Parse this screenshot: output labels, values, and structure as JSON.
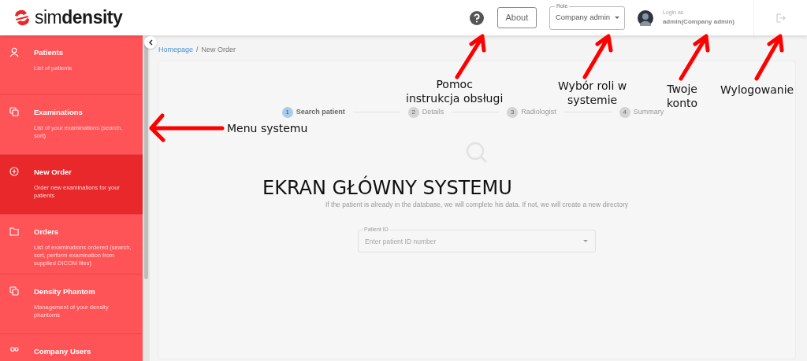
{
  "header": {
    "logo": "sim**density**",
    "about_button": "About",
    "role_select": {
      "label": "Role",
      "value": "Company admin"
    },
    "user": {
      "caption": "Login as",
      "name": "admin(Company admin)"
    }
  },
  "sidebar": {
    "items": [
      {
        "title": "Patients",
        "description": "List of patients",
        "selected": false
      },
      {
        "title": "Examinations",
        "description": "List of your examinations (search, sort)",
        "selected": false
      },
      {
        "title": "New Order",
        "description": "Order new examinations for your patients",
        "selected": true
      },
      {
        "title": "Orders",
        "description": "List of examinations ordered (search, sort, perform examination from supplied DICOM files)",
        "selected": false
      },
      {
        "title": "Density Phantom",
        "description": "Management of your density phantoms",
        "selected": false
      },
      {
        "title": "Company Users",
        "selected": false
      }
    ]
  },
  "breadcrumb": {
    "separator": "/",
    "items": [
      "Homepage",
      "New Order"
    ]
  },
  "stepper": [
    {
      "number": "1",
      "label": "Search patient",
      "selected": true
    },
    {
      "number": "2",
      "label": "Details",
      "selected": false
    },
    {
      "number": "3",
      "label": "Radiologist",
      "selected": false
    },
    {
      "number": "4",
      "label": "Summary",
      "selected": false
    }
  ],
  "subtitle": "If the patient is already in the database, we will complete his data. If not, we will create a new directory",
  "patient_field": {
    "label": "Patient ID",
    "placeholder": "Enter patient ID number"
  },
  "annotations": [
    {
      "lines": [
        "Menu systemu"
      ]
    },
    {
      "lines": [
        "Pomoc",
        "instrukcja obsługi"
      ]
    },
    {
      "lines": [
        "Wybór roli w",
        "systemie"
      ]
    },
    {
      "lines": [
        "Twoje",
        "konto"
      ]
    },
    {
      "lines": [
        "Wylogowanie"
      ]
    }
  ],
  "headline": "EKRAN GŁÓWNY SYSTEMU"
}
